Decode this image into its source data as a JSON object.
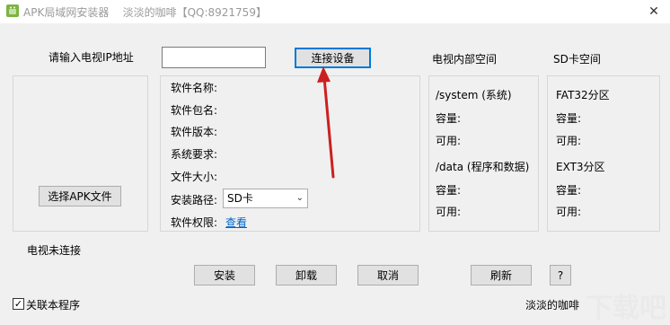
{
  "window": {
    "title": "APK局域网安装器    淡淡的咖啡【QQ:8921759】",
    "close_glyph": "✕"
  },
  "connect": {
    "ip_label": "请输入电视IP地址",
    "ip_value": "",
    "connect_button": "连接设备"
  },
  "left": {
    "choose_apk_button": "选择APK文件"
  },
  "info": {
    "software_name": "软件名称:",
    "package_name": "软件包名:",
    "version": "软件版本:",
    "system_req": "系统要求:",
    "file_size": "文件大小:",
    "install_path_label": "安装路径:",
    "install_path_value": "SD卡",
    "permission_label": "软件权限:",
    "permission_link": "查看"
  },
  "internal": {
    "header": "电视内部空间",
    "system": "/system (系统)",
    "system_capacity": "容量:",
    "system_available": "可用:",
    "data": "/data (程序和数据)",
    "data_capacity": "容量:",
    "data_available": "可用:"
  },
  "sd": {
    "header": "SD卡空间",
    "fat32": "FAT32分区",
    "fat32_capacity": "容量:",
    "fat32_available": "可用:",
    "ext3": "EXT3分区",
    "ext3_capacity": "容量:",
    "ext3_available": "可用:"
  },
  "status": "电视未连接",
  "buttons": {
    "install": "安装",
    "uninstall": "卸载",
    "cancel": "取消",
    "refresh": "刷新",
    "help": "?"
  },
  "footer": {
    "associate_checkbox": "关联本程序",
    "checked": true,
    "author": "淡淡的咖啡"
  },
  "watermark": "下载吧",
  "colors": {
    "arrow": "#cc1f1f",
    "link": "#0066cc",
    "focus_border": "#0078d7"
  }
}
